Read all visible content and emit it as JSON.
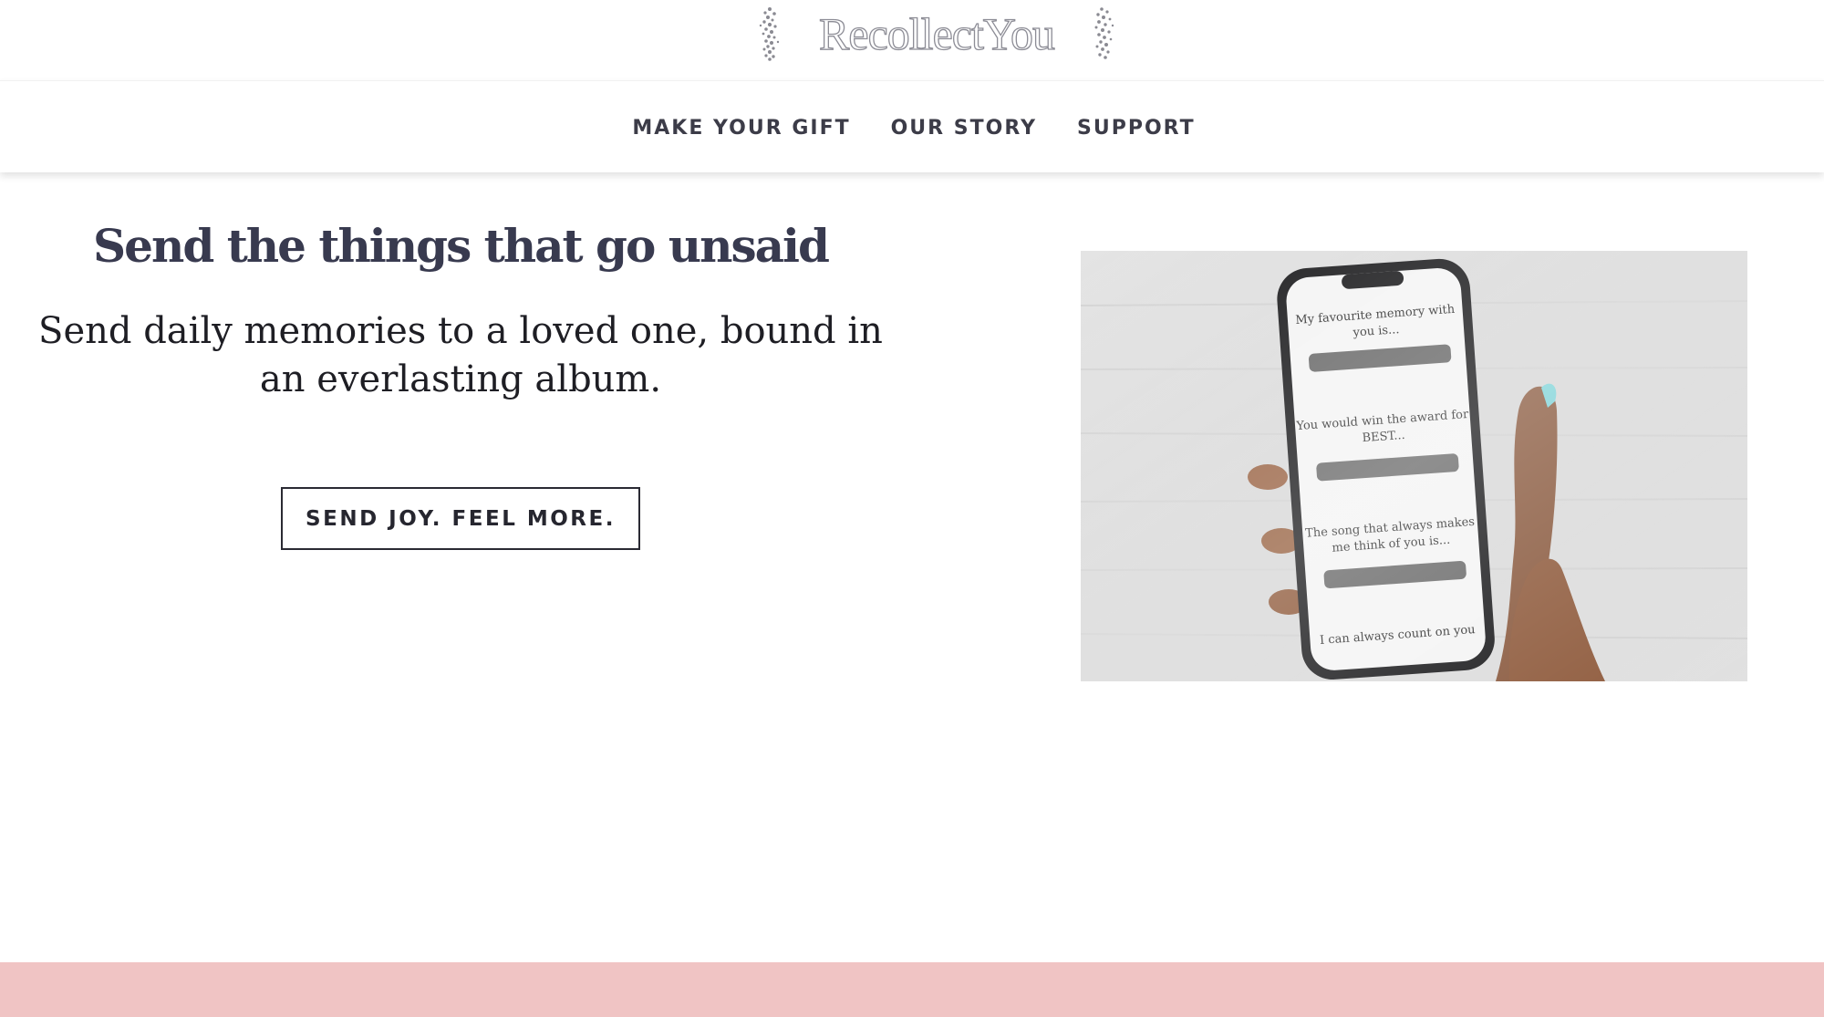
{
  "brand": {
    "name": "RecollectYou"
  },
  "nav": {
    "items": [
      {
        "label": "MAKE YOUR GIFT"
      },
      {
        "label": "OUR STORY"
      },
      {
        "label": "SUPPORT"
      }
    ]
  },
  "hero": {
    "title": "Send the things that go unsaid",
    "subtitle": "Send daily memories to a loved one, bound in an everlasting album.",
    "cta_label": "SEND JOY. FEEL MORE."
  },
  "phone_screen": {
    "prompts": [
      "My favourite memory with you is...",
      "You would win the award for BEST...",
      "The song that always makes me think of you is...",
      "I can always count on you"
    ]
  },
  "colors": {
    "heading": "#383a4f",
    "nav_text": "#3c3c48",
    "footer_band": "#f0c4c4"
  }
}
